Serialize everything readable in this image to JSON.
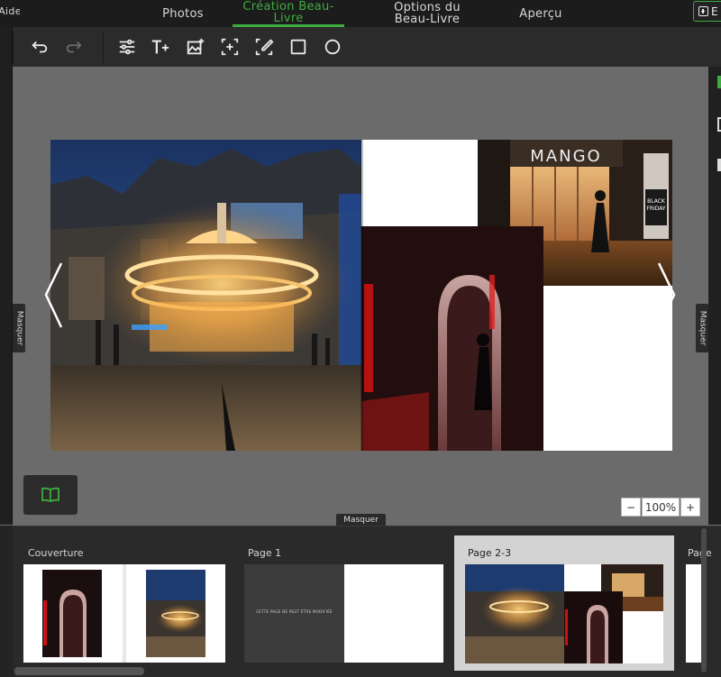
{
  "nav": {
    "aide": "Aide",
    "photos": "Photos",
    "creation": "Création Beau-Livre",
    "options": "Options du Beau-Livre",
    "apercu": "Aperçu",
    "export_label": "E"
  },
  "toolbar": {
    "tools": [
      "undo-icon",
      "redo-icon",
      "sliders-icon",
      "add-text-icon",
      "add-photo-icon",
      "add-frame-icon",
      "edit-frame-icon",
      "rectangle-icon",
      "circle-icon"
    ]
  },
  "canvas": {
    "masquer_left": "Masquer",
    "masquer_right": "Masquer",
    "masquer_bottom": "Masquer",
    "store_sign": "MANGO",
    "black_friday": "BLACK FRIDAY"
  },
  "zoom": {
    "value": "100%",
    "minus": "−",
    "plus": "+"
  },
  "pages": [
    {
      "label": "Couverture"
    },
    {
      "label": "Page 1",
      "text": "CETTE PAGE NE PEUT ÊTRE MODIFIÉE"
    },
    {
      "label": "Page 2-3"
    },
    {
      "label": "Page"
    }
  ],
  "colors": {
    "accent": "#3dac3f",
    "panel": "#2b2b2b",
    "canvas_bg": "#6b6b6b"
  }
}
